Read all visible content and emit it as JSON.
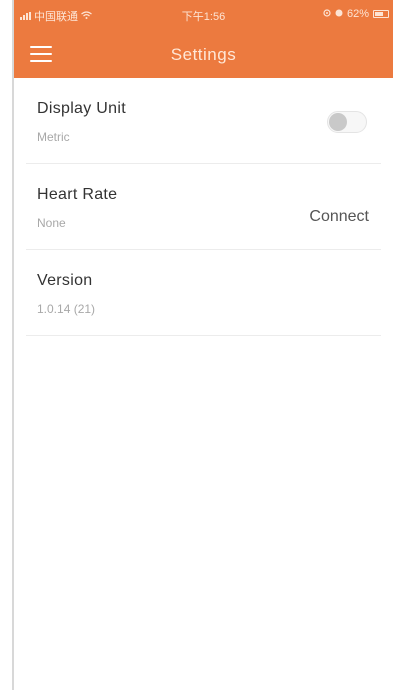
{
  "status_bar": {
    "carrier": "中国联通",
    "time": "下午1:56",
    "battery": "62%"
  },
  "header": {
    "title": "Settings",
    "menu_icon": "hamburger-menu-icon",
    "color": "#ec7a3f"
  },
  "settings": {
    "display_unit": {
      "label": "Display Unit",
      "value": "Metric",
      "toggle_on": false
    },
    "heart_rate": {
      "label": "Heart Rate",
      "value": "None",
      "action": "Connect"
    },
    "version": {
      "label": "Version",
      "value": "1.0.14 (21)"
    }
  }
}
